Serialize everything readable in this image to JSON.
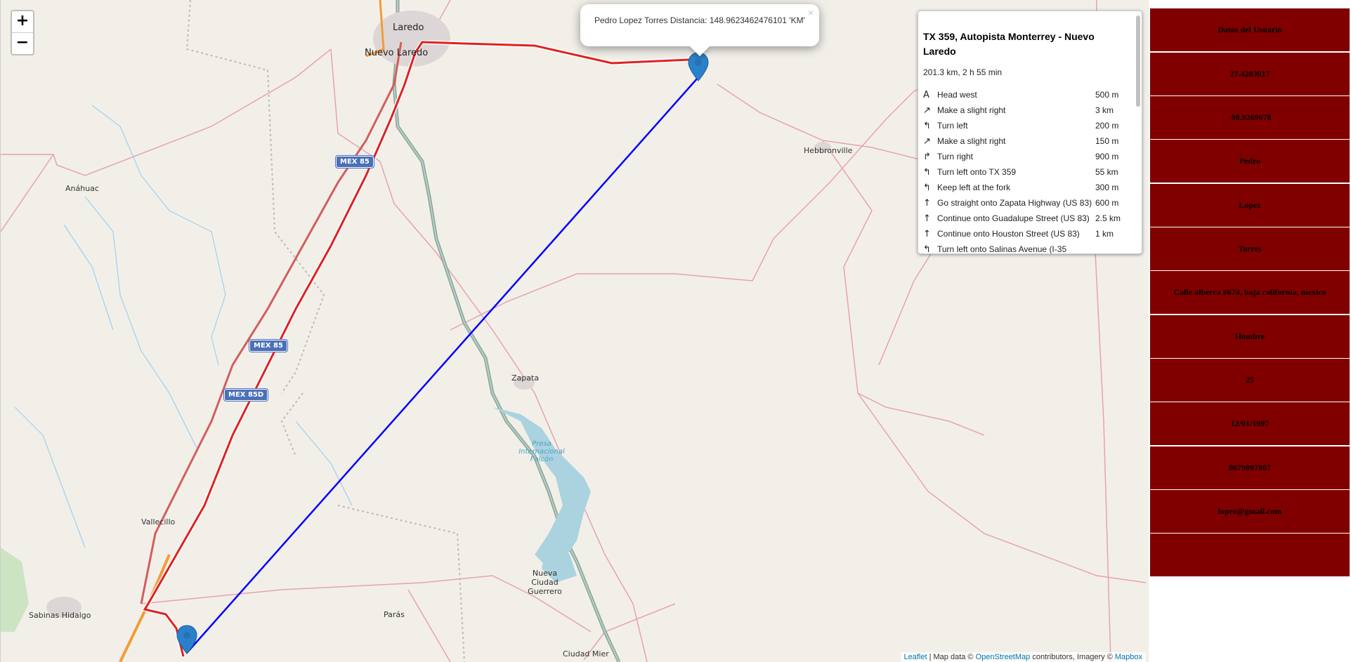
{
  "map": {
    "zoom_in_label": "+",
    "zoom_out_label": "−",
    "places": {
      "laredo": "Laredo",
      "nuevo_laredo": "Nuevo Laredo",
      "anahuac": "Anáhuac",
      "hebbronville": "Hebbronville",
      "zapata": "Zapata",
      "vallecillo": "Vallecillo",
      "sabinas_hidalgo": "Sabinas Hidalgo",
      "paras": "Parás",
      "nueva_ciudad_guerrero": "Nueva Ciudad Guerrero",
      "ciudad_mier": "Ciudad Mier",
      "presa": "Presa Internacional Falcón"
    },
    "shields": {
      "mex85_a": "MEX 85",
      "mex85_b": "MEX 85",
      "mex85d": "MEX 85D"
    },
    "popup": {
      "text": "Pedro Lopez Torres Distancia: 148.9623462476101 'KM'",
      "close_label": "×"
    },
    "routing": {
      "title": "TX 359, Autopista Monterrey - Nuevo Laredo",
      "summary": "201.3 km, 2 h 55 min",
      "steps": [
        {
          "icon": "A",
          "text": "Head west",
          "distance": "500 m"
        },
        {
          "icon": "↗",
          "text": "Make a slight right",
          "distance": "3 km"
        },
        {
          "icon": "↰",
          "text": "Turn left",
          "distance": "200 m"
        },
        {
          "icon": "↗",
          "text": "Make a slight right",
          "distance": "150 m"
        },
        {
          "icon": "↱",
          "text": "Turn right",
          "distance": "900 m"
        },
        {
          "icon": "↰",
          "text": "Turn left onto TX 359",
          "distance": "55 km"
        },
        {
          "icon": "↰",
          "text": "Keep left at the fork",
          "distance": "300 m"
        },
        {
          "icon": "↑",
          "text": "Go straight onto Zapata Highway (US 83)",
          "distance": "600 m"
        },
        {
          "icon": "↑",
          "text": "Continue onto Guadalupe Street (US 83)",
          "distance": "2.5 km"
        },
        {
          "icon": "↑",
          "text": "Continue onto Houston Street (US 83)",
          "distance": "1 km"
        },
        {
          "icon": "↰",
          "text": "Turn left onto Salinas Avenue (I-35",
          "distance": ""
        }
      ]
    },
    "attribution": {
      "leaflet": "Leaflet",
      "sep1": " | Map data © ",
      "osm": "OpenStreetMap",
      "sep2": " contributors, Imagery © ",
      "mapbox": "Mapbox"
    }
  },
  "user_panel": {
    "header": "Datos del Usuario",
    "lat": "27.4283917",
    "lng": "-98.9269678",
    "first_name": "Pedro",
    "last_name": "Lopez",
    "second_last_name": "Torres",
    "address": "Calle alberca #674, baja california, mexico",
    "gender": "Hombre",
    "age": "25",
    "birth_date": "12/01/1997",
    "phone": "8679097867",
    "email": "lopez@gmail.com"
  },
  "colors": {
    "panel_bg": "#800000",
    "route_line": "#e02020",
    "straight_line": "#0000ff",
    "marker": "#2a81cb"
  }
}
